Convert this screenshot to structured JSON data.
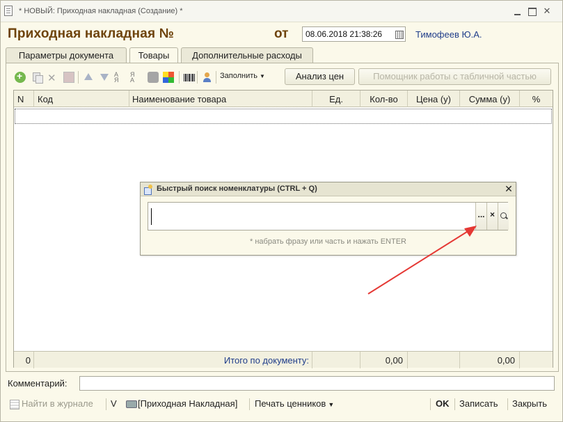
{
  "window": {
    "title": "* НОВЫЙ: Приходная накладная (Создание) *"
  },
  "header": {
    "doc_title": "Приходная накладная №",
    "date_label": "от",
    "date_value": "08.06.2018 21:38:26",
    "user": "Тимофеев Ю.А."
  },
  "tabs": [
    {
      "label": "Параметры документа"
    },
    {
      "label": "Товары"
    },
    {
      "label": "Дополнительные расходы"
    }
  ],
  "toolbar": {
    "fill_label": "Заполнить",
    "analyze_label": "Анализ цен",
    "helper_label": "Помощник работы с табличной частью"
  },
  "table": {
    "columns": [
      "N",
      "Код",
      "Наименование товара",
      "Ед.",
      "Кол-во",
      "Цена (у)",
      "Сумма (у)",
      "%"
    ],
    "footer": {
      "count": "0",
      "total_label": "Итого по документу:",
      "qty_total": "0,00",
      "sum_total": "0,00"
    }
  },
  "quick_search": {
    "title": "Быстрый поиск номенклатуры (CTRL + Q)",
    "value": "",
    "dots_label": "...",
    "clear_label": "×",
    "hint": "* набрать фразу или часть и нажать ENTER"
  },
  "comment": {
    "label": "Комментарий:",
    "value": ""
  },
  "bottom": {
    "journal_label": "Найти в журнале",
    "v_label": "V",
    "print_label": "[Приходная Накладная]",
    "tags_label": "Печать ценников",
    "ok_label": "OK",
    "save_label": "Записать",
    "close_label": "Закрыть"
  },
  "colors": {
    "header_text": "#6e430b",
    "link_text": "#1f3d8a",
    "arrow": "#e53935",
    "panel_bg": "#fbf9ea"
  },
  "icons": [
    "doc-icon",
    "calendar-icon",
    "add-icon",
    "copy-icon",
    "delete-icon",
    "mark-icon",
    "move-up-icon",
    "move-down-icon",
    "sort-asc-icon",
    "sort-desc-icon",
    "database-icon",
    "color-icon",
    "barcode-icon",
    "user-icon",
    "search-magnifier-icon",
    "printer-icon",
    "journal-icon"
  ]
}
